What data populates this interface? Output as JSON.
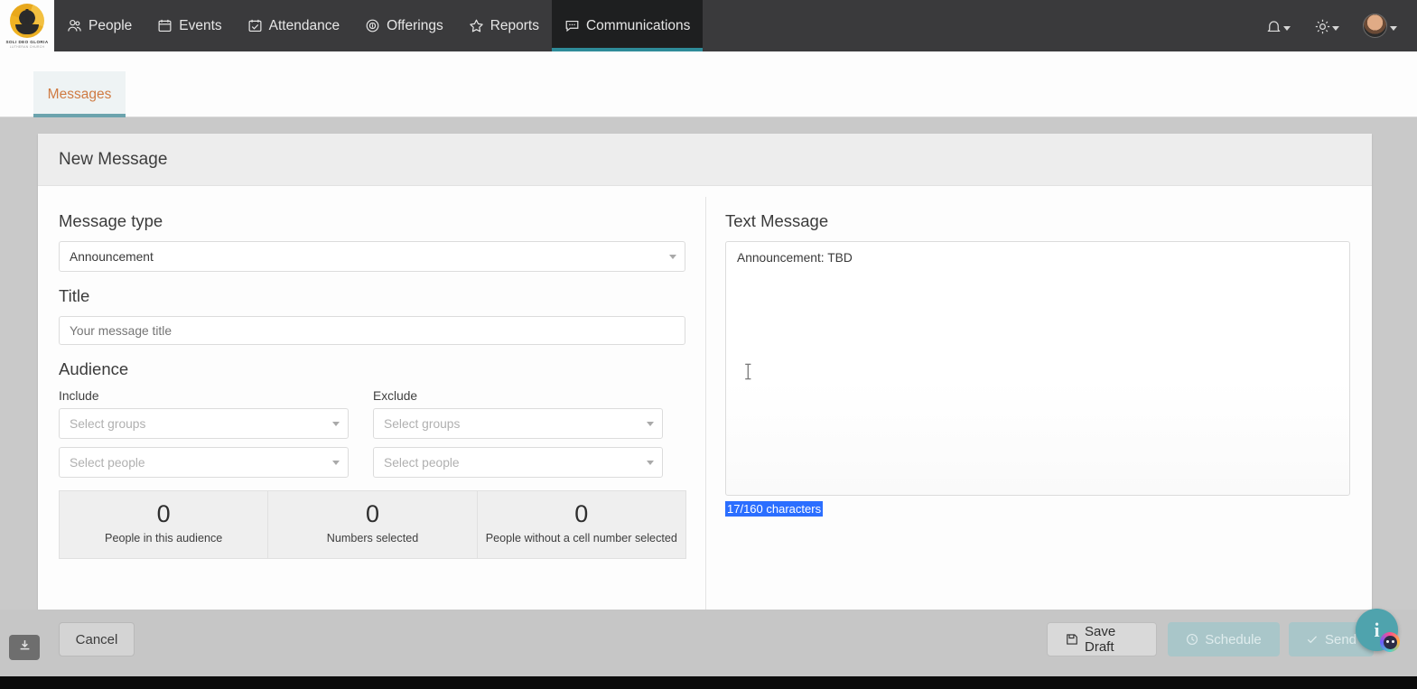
{
  "navbar": {
    "logo": {
      "name": "SOLI DEO GLORIA",
      "subtitle": "LUTHERAN CHURCH"
    },
    "items": [
      {
        "label": "People",
        "icon": "people-icon",
        "active": false
      },
      {
        "label": "Events",
        "icon": "calendar-icon",
        "active": false
      },
      {
        "label": "Attendance",
        "icon": "calendar-check-icon",
        "active": false
      },
      {
        "label": "Offerings",
        "icon": "coin-dollar-icon",
        "active": false
      },
      {
        "label": "Reports",
        "icon": "star-icon",
        "active": false
      },
      {
        "label": "Communications",
        "icon": "chat-bubble-icon",
        "active": true
      }
    ],
    "tools": [
      {
        "name": "notifications-bell",
        "icon": "bell-icon"
      },
      {
        "name": "settings-gear",
        "icon": "gear-icon"
      },
      {
        "name": "user-avatar",
        "icon": "avatar-icon"
      }
    ]
  },
  "tabs": [
    {
      "label": "Messages",
      "active": true
    }
  ],
  "card": {
    "header_title": "New Message"
  },
  "form": {
    "message_type": {
      "label": "Message type",
      "value": "Announcement"
    },
    "title": {
      "label": "Title",
      "value": "",
      "placeholder": "Your message title"
    },
    "audience": {
      "label": "Audience",
      "include_label": "Include",
      "exclude_label": "Exclude",
      "include_groups_placeholder": "Select groups",
      "include_people_placeholder": "Select people",
      "exclude_groups_placeholder": "Select groups",
      "exclude_people_placeholder": "Select people",
      "stats": [
        {
          "value": "0",
          "label": "People in this audience"
        },
        {
          "value": "0",
          "label": "Numbers selected"
        },
        {
          "value": "0",
          "label": "People without a cell number selected"
        }
      ]
    }
  },
  "text_message": {
    "label": "Text Message",
    "value": "Announcement: TBD",
    "char_count": "17/160 characters",
    "selection_color": "#2b6eff"
  },
  "footer": {
    "cancel_label": "Cancel",
    "save_draft_label": "Save Draft",
    "schedule_label": "Schedule",
    "send_label": "Send"
  },
  "overlays": {
    "download_icon": "download-icon",
    "help_fab": "info-fab"
  },
  "theme": {
    "navbar_bg": "#3a3a3c",
    "active_nav_bg": "#1e1f20",
    "accent_teal": "#2e8b99",
    "tab_text": "#cf7b43",
    "page_bg": "#c9c9c9"
  }
}
